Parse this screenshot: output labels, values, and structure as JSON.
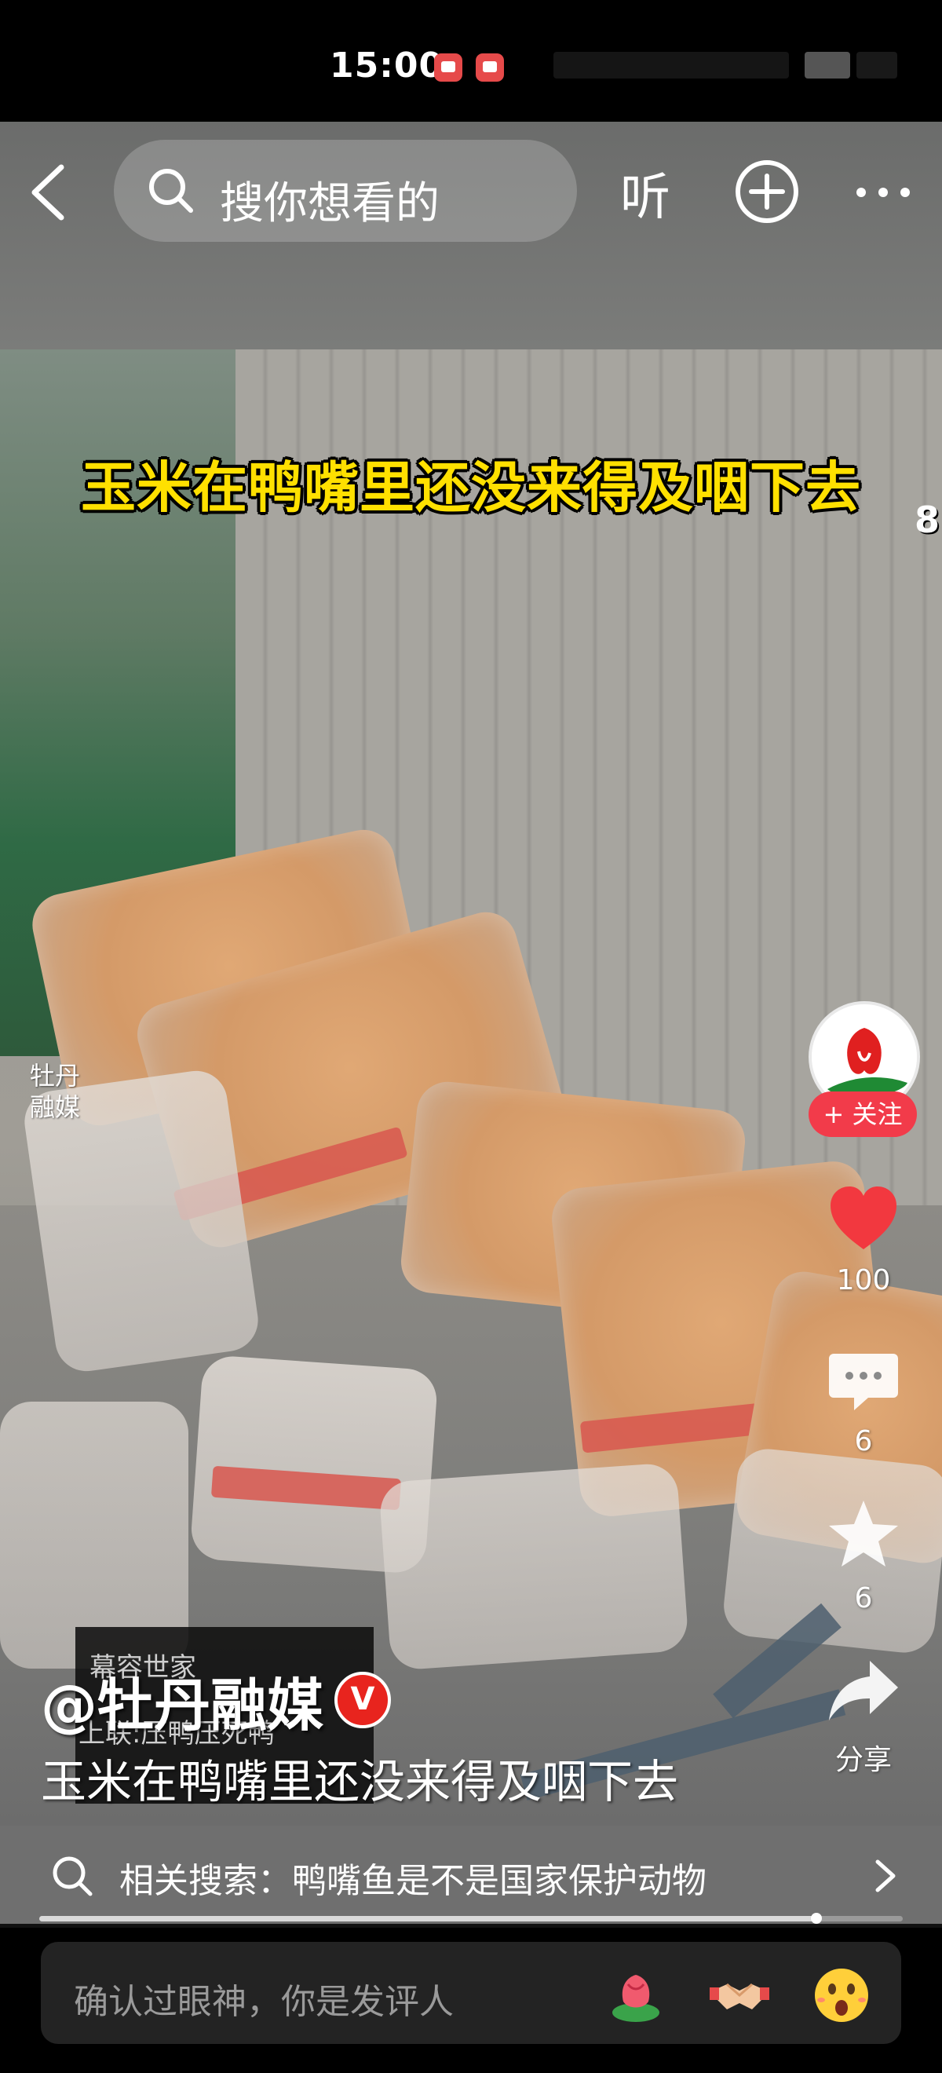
{
  "status_bar": {
    "time": "15:00"
  },
  "top_nav": {
    "search_placeholder": "搜你想看的",
    "listen_label": "听"
  },
  "video": {
    "caption": "玉米在鸭嘴里还没来得及咽下去",
    "watermark_line1": "牡丹",
    "watermark_line2": "融媒",
    "edge_char": "8",
    "overlay_line1": "幕容世家",
    "overlay_line2": "上联:压鸭压死鸭"
  },
  "author": {
    "name": "@牡丹融媒",
    "verified_badge": "V"
  },
  "video_title": "玉米在鸭嘴里还没来得及咽下去",
  "actions": {
    "follow_label": "+ 关注",
    "like_count": "100",
    "comment_count": "6",
    "favorite_count": "6",
    "share_label": "分享"
  },
  "related_search": {
    "text": "相关搜索：鸭嘴鱼是不是国家保护动物"
  },
  "playback": {
    "progress_fraction": 0.9
  },
  "comment_bar": {
    "placeholder": "确认过眼神，你是发评人"
  },
  "colors": {
    "accent_red": "#f23b4a",
    "caption_yellow": "#ffe000"
  }
}
